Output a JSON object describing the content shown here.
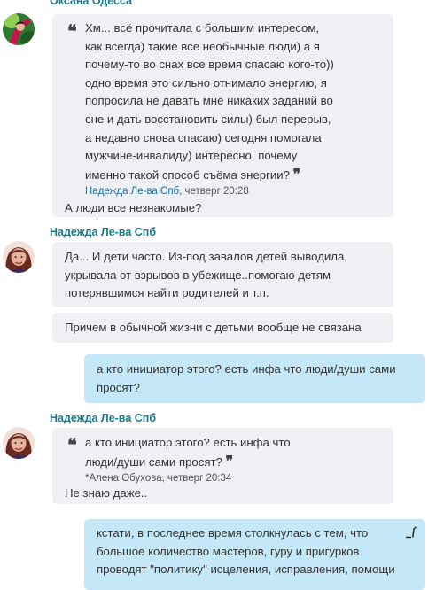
{
  "messages": [
    {
      "sender": "Оксана Одесса",
      "quote": {
        "text": "Хм... всё прочитала с большим интересом, как всегда) такие все необычные люди) а я почему-то во снах все время спасаю кого-то)) одно время это сильно отнимало энергию, я попросила не давать мне никаких заданий во сне и дать восстановить силы) был перерыв, а недавно снова спасаю) сегодня помогала мужчине-инвалиду) интересно, почему именно такой способ съёма энергии?",
        "author": "Надежда Ле-ва Спб",
        "time": ", четверг 20:28"
      },
      "text": "А люди все незнакомые?"
    },
    {
      "sender": "Надежда Ле-ва Спб",
      "text1": "Да... И дети часто. Из-под завалов детей выводила, укрывала от взрывов в убежище..помогаю детям потерявшимся найти родителей и т.п.",
      "text2": "Причем в обычной жизни с детьми вообще не связана"
    },
    {
      "text": "а кто инициатор этого? есть инфа что люди/души сами просят?"
    },
    {
      "sender": "Надежда Ле-ва Спб",
      "quote": {
        "text": "а кто инициатор этого? есть инфа что люди/души сами просят?",
        "author": "*Алена Обухова",
        "time": ", четверг 20:34"
      },
      "text": "Не знаю даже.."
    },
    {
      "text": "кстати, в последнее время столкнулась с тем, что большое количество мастеров, гуру и пригурков проводят \"политику\" исцеления, исправления, помощи",
      "edit_icon": "edit-pencil-icon"
    }
  ],
  "quote_open": "❝",
  "quote_close": "❞"
}
